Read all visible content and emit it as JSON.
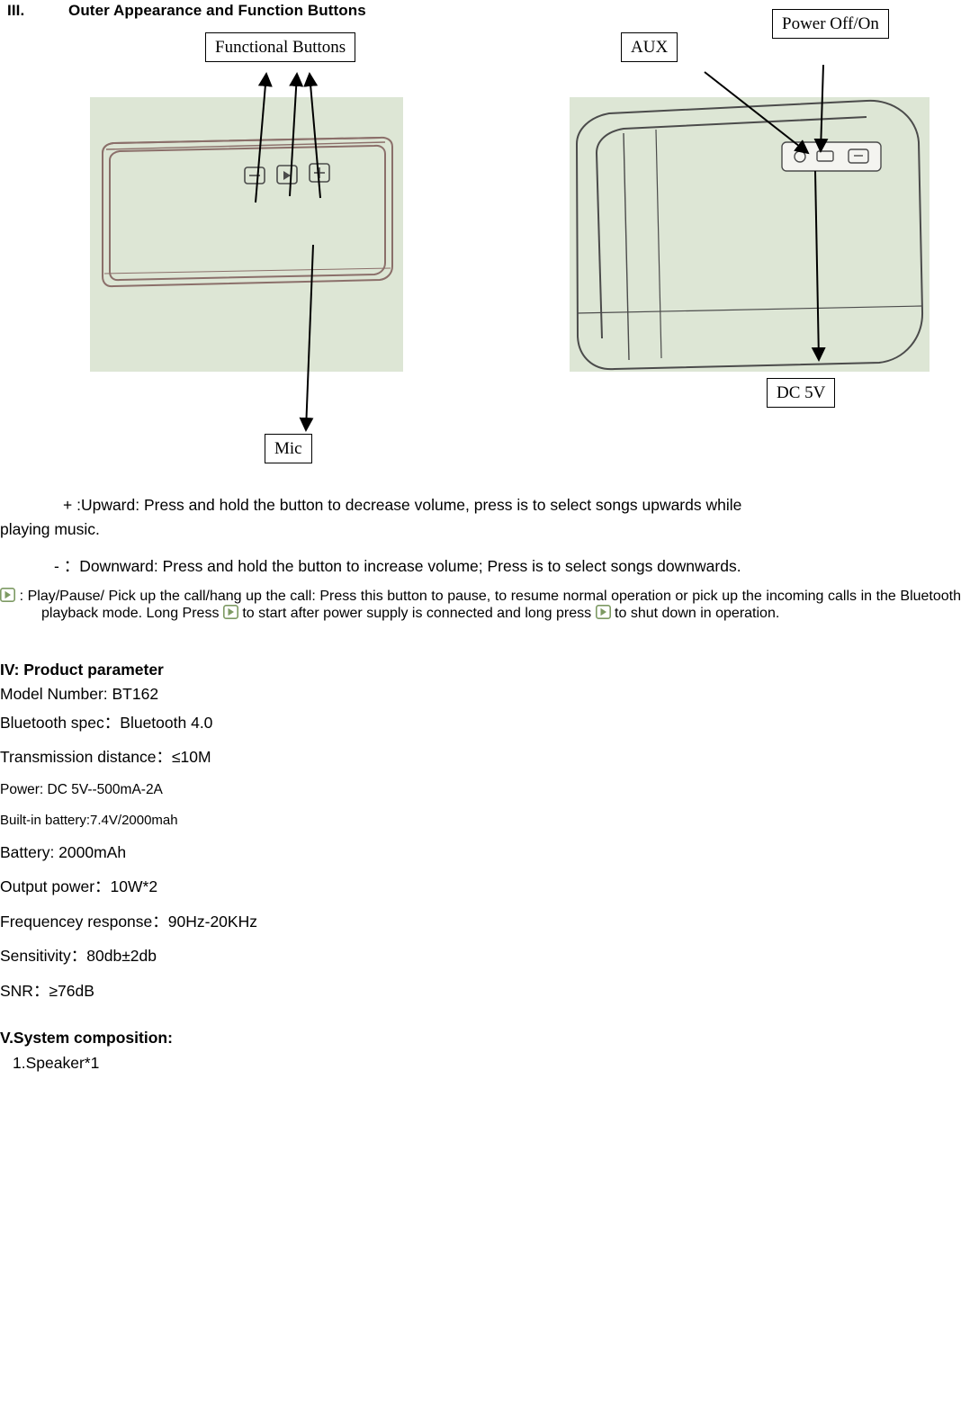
{
  "heading": {
    "number": "III.",
    "title": "Outer Appearance and Function Buttons"
  },
  "callouts": {
    "functional_buttons": "Functional Buttons",
    "aux": "AUX",
    "power": "Power Off/On",
    "mic": "Mic",
    "dc": "DC 5V"
  },
  "instructions": {
    "upward": "+    :Upward: Press and hold the button to decrease volume, press is to select songs upwards while",
    "upward_cont": "playing music.",
    "downward": "-     ：Downward: Press and hold the button to increase volume; Press is to select songs downwards.",
    "play_label": ":",
    "play_text_1": "Play/Pause/ Pick up the call/hang up the call: Press this button to pause, to resume normal operation or pick up the incoming calls in the Bluetooth playback mode. Long Press",
    "play_text_2": "to start after power supply is connected and long press",
    "play_text_3": "to shut down in operation."
  },
  "parameters": {
    "heading": "IV: Product parameter",
    "lines": [
      "Model Number: BT162",
      "Bluetooth spec：Bluetooth 4.0",
      "Transmission distance：≤10M",
      "Power: DC 5V--500mA-2A",
      "Built-in battery:7.4V/2000mah",
      "Battery: 2000mAh",
      "Output power：10W*2",
      "Frequencey response：90Hz-20KHz",
      "Sensitivity：80db±2db",
      "SNR：≥76dB"
    ]
  },
  "system": {
    "heading": "V.System composition:",
    "items": [
      "1.Speaker*1"
    ]
  }
}
